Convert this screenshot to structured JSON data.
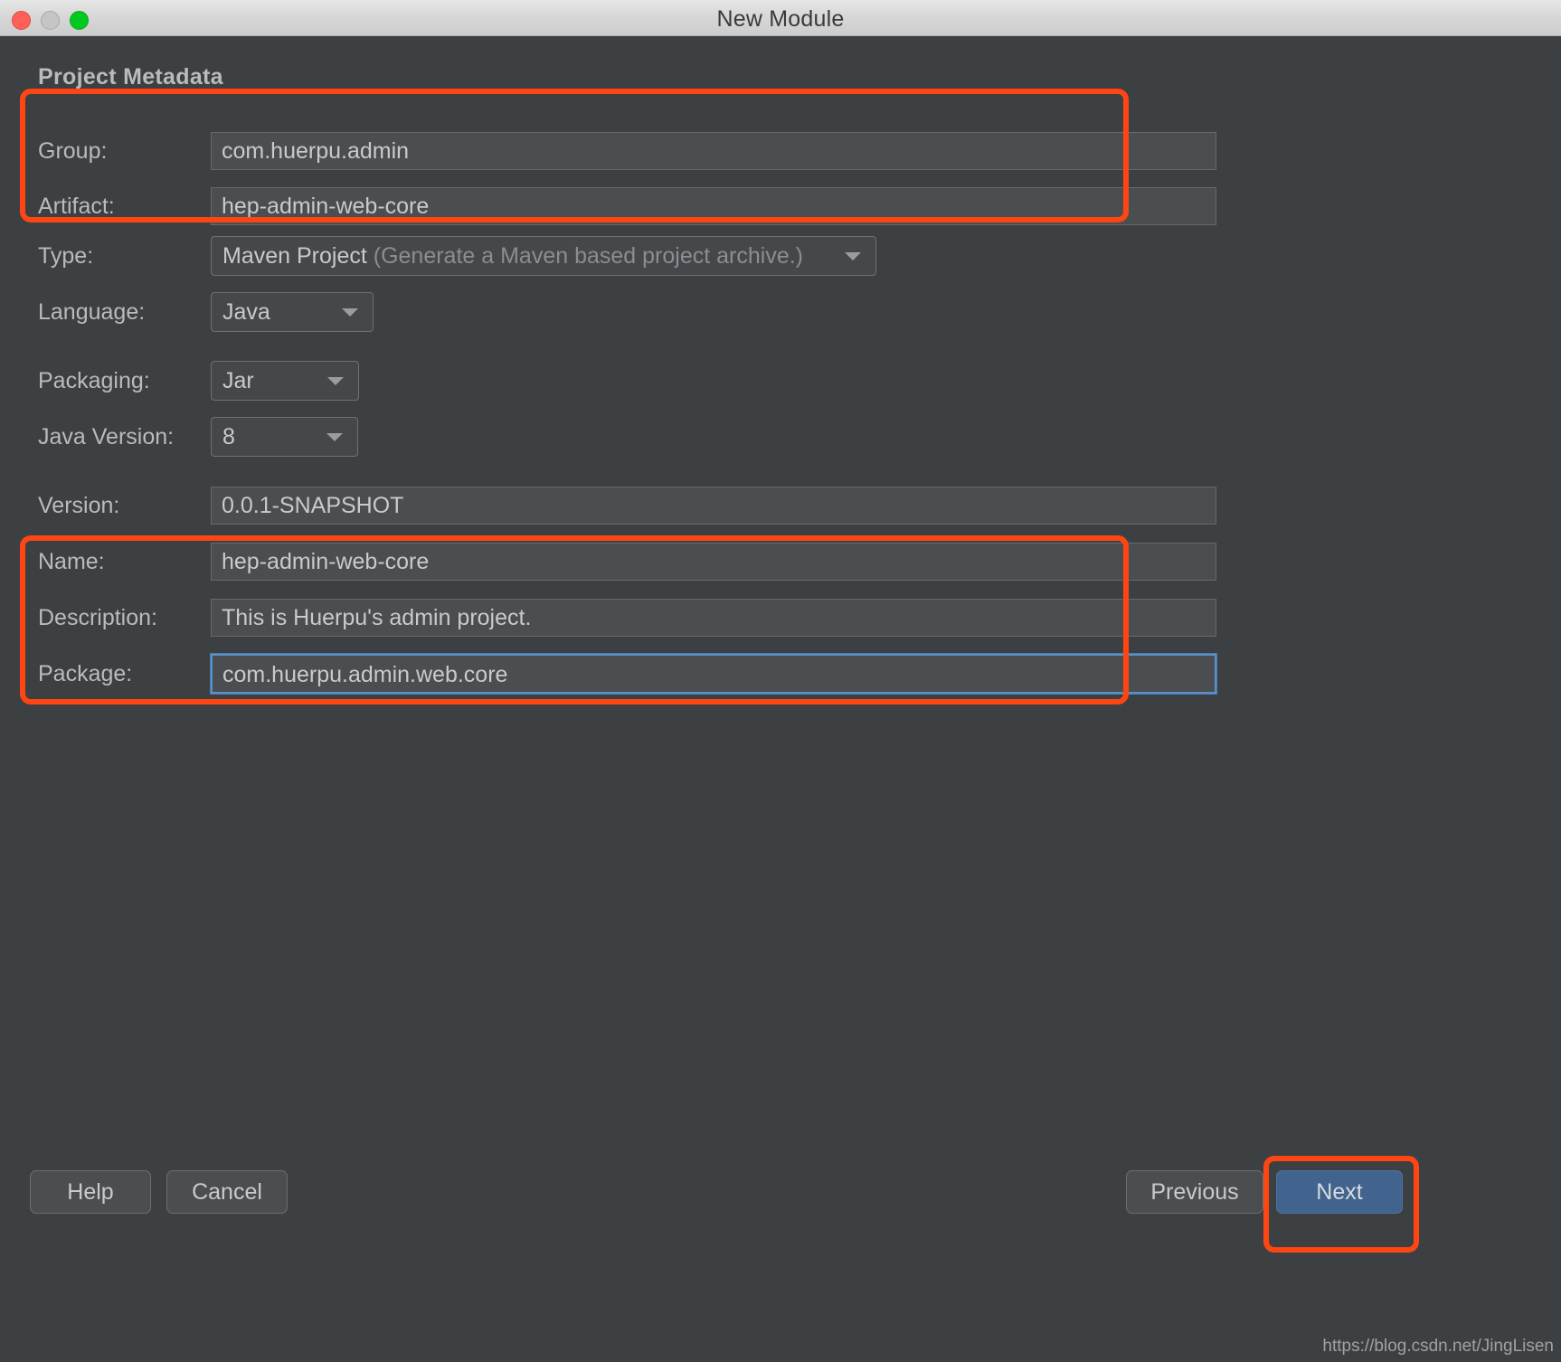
{
  "window": {
    "title": "New Module",
    "controls": [
      "close",
      "minimize",
      "maximize"
    ]
  },
  "section": {
    "title": "Project Metadata"
  },
  "form": {
    "group": {
      "label": "Group:",
      "value": "com.huerpu.admin"
    },
    "artifact": {
      "label": "Artifact:",
      "value": "hep-admin-web-core"
    },
    "type": {
      "label": "Type:",
      "value": "Maven Project",
      "hint": "(Generate a Maven based project archive.)"
    },
    "language": {
      "label": "Language:",
      "value": "Java"
    },
    "packaging": {
      "label": "Packaging:",
      "value": "Jar"
    },
    "java_version": {
      "label": "Java Version:",
      "value": "8"
    },
    "version": {
      "label": "Version:",
      "value": "0.0.1-SNAPSHOT"
    },
    "name": {
      "label": "Name:",
      "value": "hep-admin-web-core"
    },
    "description": {
      "label": "Description:",
      "value": "This is Huerpu's admin project."
    },
    "package": {
      "label": "Package:",
      "value": "com.huerpu.admin.web.core"
    }
  },
  "buttons": {
    "help": "Help",
    "cancel": "Cancel",
    "previous": "Previous",
    "next": "Next"
  },
  "watermark": "https://blog.csdn.net/JingLisen",
  "colors": {
    "annotation": "#ff4612",
    "primary_button": "#41638d",
    "focus_border": "#5c90c4",
    "dialog_bg": "#3c4043",
    "field_bg": "#4a4e51"
  }
}
